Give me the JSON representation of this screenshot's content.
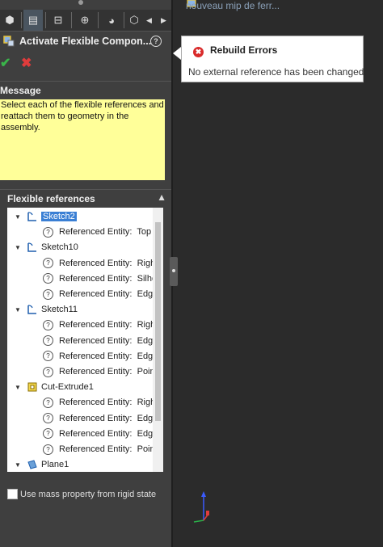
{
  "tabs": [
    {
      "name": "feature-manager-tab-icon",
      "glyph": "⬢"
    },
    {
      "name": "property-manager-tab-icon",
      "glyph": "▤"
    },
    {
      "name": "configuration-manager-tab-icon",
      "glyph": "⊟"
    },
    {
      "name": "dimxpert-manager-tab-icon",
      "glyph": "⊕"
    },
    {
      "name": "display-manager-tab-icon",
      "glyph": "◕"
    },
    {
      "name": "custom-tab-icon",
      "glyph": "⬡"
    }
  ],
  "tab_nav": {
    "left": "◀",
    "right": "▶"
  },
  "property_manager": {
    "title": "Activate Flexible Compon...",
    "help": "?",
    "ok": "✔",
    "cancel": "✖"
  },
  "message_section": {
    "heading": "Message",
    "collapse": "▲",
    "text": "Select each of the flexible references and reattach them to geometry in the assembly."
  },
  "flexible_section": {
    "heading": "Flexible references",
    "collapse": "▲",
    "tree": [
      {
        "type": "sketch",
        "label": "Sketch2",
        "selected": true,
        "children": [
          "Referenced Entity:  Top F"
        ]
      },
      {
        "type": "sketch",
        "label": "Sketch10",
        "selected": false,
        "children": [
          "Referenced Entity:  Right",
          "Referenced Entity:  Silhou",
          "Referenced Entity:  Edge"
        ]
      },
      {
        "type": "sketch",
        "label": "Sketch11",
        "selected": false,
        "children": [
          "Referenced Entity:  Right",
          "Referenced Entity:  Edge",
          "Referenced Entity:  Edge",
          "Referenced Entity:  Point"
        ]
      },
      {
        "type": "cut-extrude",
        "label": "Cut-Extrude1",
        "selected": false,
        "children": [
          "Referenced Entity:  Right",
          "Referenced Entity:  Edge",
          "Referenced Entity:  Edge",
          "Referenced Entity:  Point"
        ]
      },
      {
        "type": "plane",
        "label": "Plane1",
        "selected": false,
        "children": []
      }
    ]
  },
  "mass_property": {
    "label": "Use mass property from rigid state",
    "checked": false
  },
  "graphics": {
    "assembly_label": "nouveau mip de ferr...",
    "error_popup": {
      "title": "Rebuild Errors",
      "message": "No external reference has been changed",
      "icon": "✖"
    }
  },
  "colors": {
    "panel_bg": "#3f3f3f",
    "graphics_bg": "#2b2b2b",
    "message_bg": "#ffff99",
    "selection": "#3a7fd4",
    "ok_green": "#3ab54a",
    "cancel_red": "#e03c3c",
    "error_red": "#d92b2b"
  }
}
